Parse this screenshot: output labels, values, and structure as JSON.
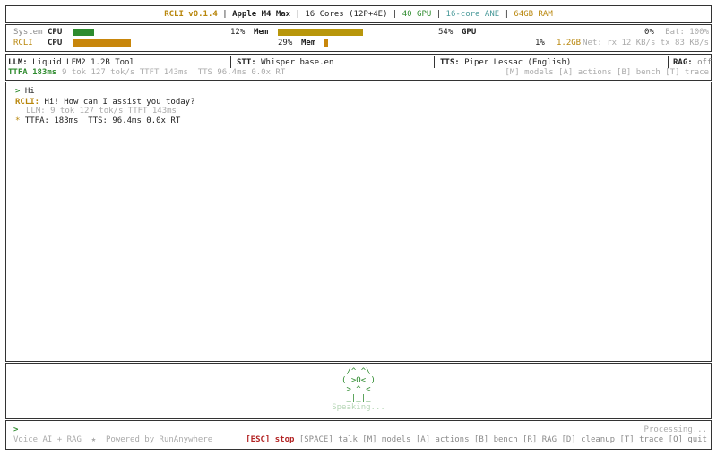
{
  "header": {
    "app": "RCLI v0.1.4",
    "chip": "Apple M4 Max",
    "cores": "16 Cores (12P+4E)",
    "gpu": "40 GPU",
    "ane": "16-core ANE",
    "ram": "64GB RAM",
    "sep": " | "
  },
  "stats": {
    "system": {
      "label": "System",
      "cpu_label": "CPU",
      "cpu_pct_text": "12%",
      "cpu_fraction": 0.12,
      "mem_label": "Mem",
      "mem_pct_text": "54%",
      "mem_fraction": 0.54,
      "gpu_label": "GPU",
      "gpu_pct_text": "0%",
      "bat": "Bat: 100%"
    },
    "rcli": {
      "label": "RCLI",
      "cpu_label": "CPU",
      "cpu_pct_text": "29%",
      "cpu_fraction": 0.29,
      "mem_label": "Mem",
      "mem_pct_text": "1%",
      "mem_fraction": 0.01,
      "mem_size": "1.2GB",
      "net": "Net: rx 12 KB/s tx 83 KB/s"
    },
    "colors": {
      "green": "#2e8b2e",
      "gold": "#b8860b"
    }
  },
  "models": {
    "llm_label": "LLM:",
    "llm_value": "Liquid LFM2 1.2B Tool",
    "stt_label": "STT:",
    "stt_value": "Whisper base.en",
    "tts_label": "TTS:",
    "tts_value": "Piper Lessac (English)",
    "rag_label": "RAG:",
    "rag_value": "off",
    "ttfa": "TTFA 183ms",
    "perf": "9 tok 127 tok/s TTFT 143ms  TTS 96.4ms 0.0x RT",
    "hints": "[M] models [A] actions [B] bench [T] trace"
  },
  "chat": {
    "user_prompt": ">",
    "user_text": "Hi",
    "rcli_label": "RCLI:",
    "rcli_text": "Hi! How can I assist you today?",
    "llm_stats": "LLM: 9 tok 127 tok/s TTFT 143ms",
    "bullet": "*",
    "ttfa_line": "TTFA: 183ms  TTS: 96.4ms 0.0x RT"
  },
  "mascot": {
    "line1": "/^ ^\\",
    "line2": "( >O< )",
    "line3": "> ^ <",
    "line4": "_|_|_",
    "status": "Speaking..."
  },
  "footer": {
    "prompt": ">",
    "processing": "Processing...",
    "tagline": "Voice AI + RAG  ★  Powered by RunAnywhere",
    "esc": "[ESC] stop",
    "keys": "[SPACE] talk [M] models [A] actions [B] bench [R] RAG [D] cleanup [T] trace [Q] quit"
  }
}
